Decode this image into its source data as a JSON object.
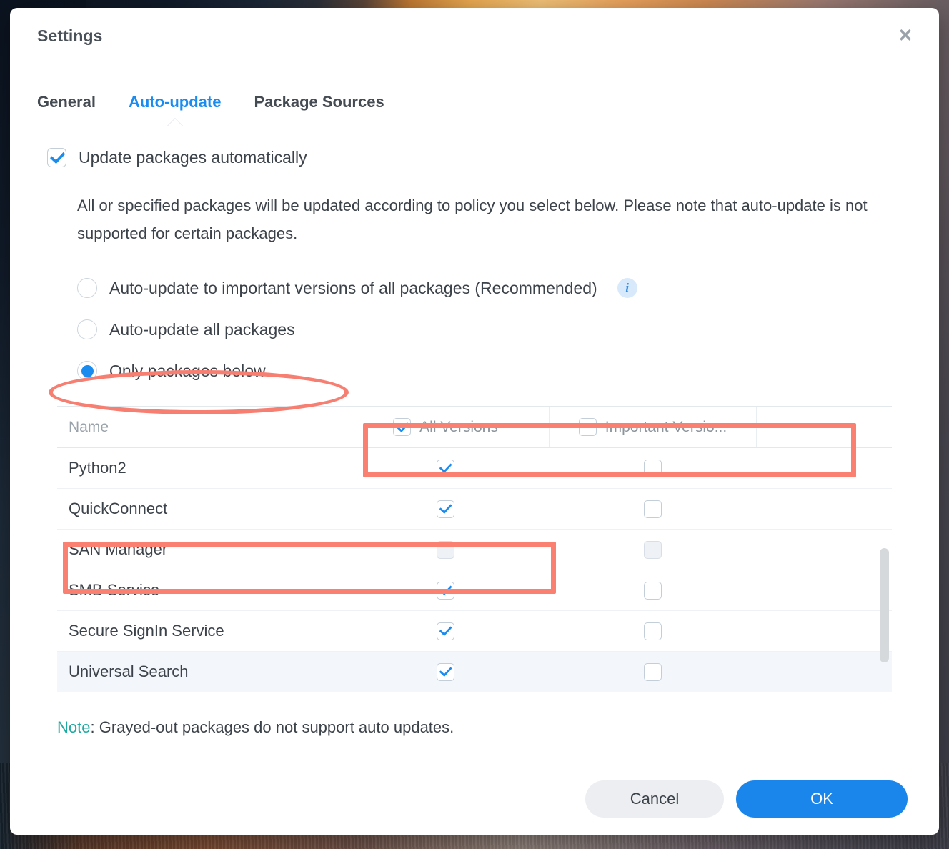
{
  "window": {
    "title": "Settings",
    "close_icon": "close-icon"
  },
  "tabs": [
    {
      "label": "General",
      "active": false
    },
    {
      "label": "Auto-update",
      "active": true
    },
    {
      "label": "Package Sources",
      "active": false
    }
  ],
  "auto_update": {
    "master_checkbox": {
      "label": "Update packages automatically",
      "checked": true
    },
    "description": "All or specified packages will be updated according to policy you select below. Please note that auto-update is not supported for certain packages.",
    "options": [
      {
        "label": "Auto-update to important versions of all packages (Recommended)",
        "selected": false,
        "info_icon": "info-icon"
      },
      {
        "label": "Auto-update all packages",
        "selected": false
      },
      {
        "label": "Only packages below",
        "selected": true
      }
    ]
  },
  "table": {
    "columns": [
      {
        "label": "Name",
        "type": "text"
      },
      {
        "label": "All Versions",
        "type": "checkbox",
        "checked": true
      },
      {
        "label": "Important Versio...",
        "type": "checkbox",
        "checked": false
      }
    ],
    "rows": [
      {
        "name": "Python2",
        "all_versions": true,
        "important_versions": false,
        "disabled": false,
        "highlight": false
      },
      {
        "name": "QuickConnect",
        "all_versions": true,
        "important_versions": false,
        "disabled": false,
        "highlight": false
      },
      {
        "name": "SAN Manager",
        "all_versions": false,
        "important_versions": false,
        "disabled": true,
        "highlight": false
      },
      {
        "name": "SMB Service",
        "all_versions": true,
        "important_versions": false,
        "disabled": false,
        "highlight": false
      },
      {
        "name": "Secure SignIn Service",
        "all_versions": true,
        "important_versions": false,
        "disabled": false,
        "highlight": false
      },
      {
        "name": "Universal Search",
        "all_versions": true,
        "important_versions": false,
        "disabled": false,
        "highlight": true
      }
    ],
    "scrollbar": "vertical-scrollbar"
  },
  "note": {
    "keyword": "Note",
    "text": ": Grayed-out packages do not support auto updates."
  },
  "footer": {
    "cancel_label": "Cancel",
    "ok_label": "OK"
  },
  "annotations": {
    "color": "#fa8072",
    "shapes": [
      {
        "kind": "ellipse",
        "target": "only-packages-below-radio"
      },
      {
        "kind": "rect",
        "target": "table-header-version-columns"
      },
      {
        "kind": "rect",
        "target": "san-manager-row"
      }
    ]
  },
  "colors": {
    "accent_blue": "#1a8cf0",
    "ok_button": "#1a86ec",
    "note_keyword": "#1fa9a0",
    "annotation_red": "#fa8072"
  }
}
